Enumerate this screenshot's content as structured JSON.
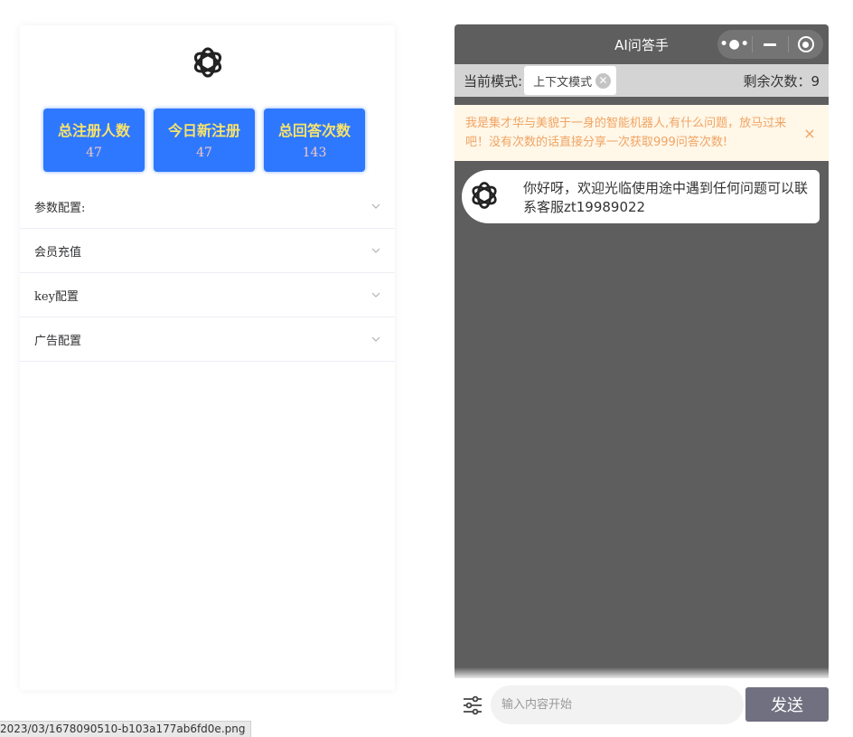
{
  "admin": {
    "logo_icon": "openai-logo-icon",
    "stats": [
      {
        "title": "总注册人数",
        "value": "47"
      },
      {
        "title": "今日新注册",
        "value": "47"
      },
      {
        "title": "总回答次数",
        "value": "143"
      }
    ],
    "config_items": [
      {
        "label": "参数配置:"
      },
      {
        "label": "会员充值"
      },
      {
        "label": "key配置"
      },
      {
        "label": "广告配置"
      }
    ]
  },
  "chat": {
    "title": "AI问答手",
    "capsule": {
      "more_icon": "more-dots-icon",
      "minimize_icon": "minimize-icon",
      "close_icon": "target-circle-icon"
    },
    "mode_label": "当前模式:",
    "mode_value": "上下文模式",
    "remaining": "剩余次数：9",
    "notice": "我是集才华与美貌于一身的智能机器人,有什么问题，放马过来吧！没有次数的话直接分享一次获取999问答次数!",
    "notice_close": "×",
    "messages": [
      {
        "avatar_icon": "openai-logo-icon",
        "text": "你好呀，欢迎光临使用途中遇到任何问题可以联系客服zt19989022"
      }
    ],
    "input_placeholder": "输入内容开始",
    "send_label": "发送"
  },
  "status_url": "2023/03/1678090510-b103a177ab6fd0e.png",
  "colors": {
    "accent": "#2e78ff",
    "stat_title": "#f8e36a",
    "chat_bg": "#5e5e5e",
    "send_btn": "#717080",
    "notice_text": "#f0a463"
  }
}
